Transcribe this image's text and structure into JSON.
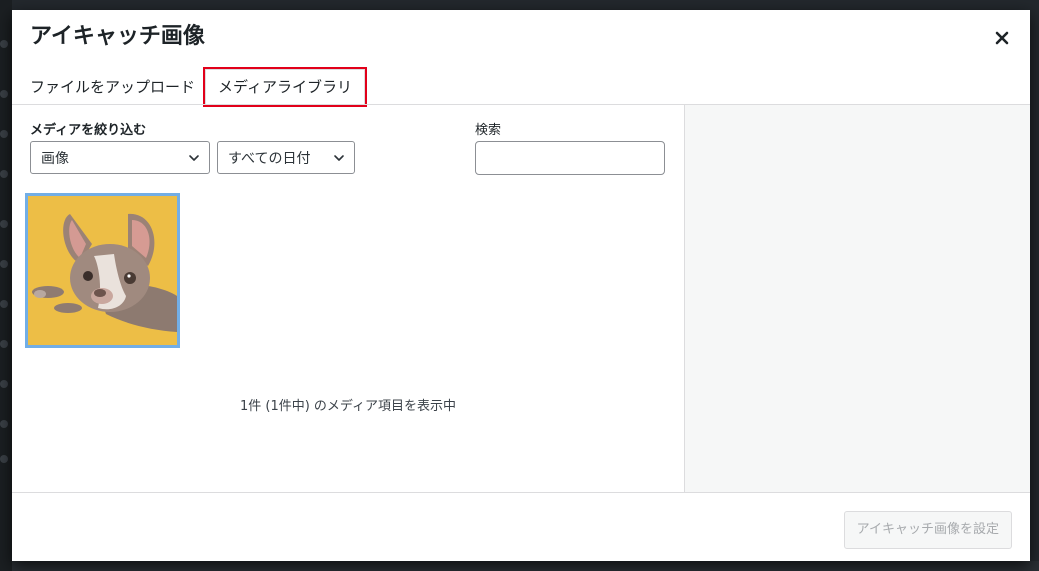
{
  "modal": {
    "title": "アイキャッチ画像",
    "close_icon": "close-icon"
  },
  "tabs": [
    {
      "label": "ファイルをアップロード",
      "active": false
    },
    {
      "label": "メディアライブラリ",
      "active": true,
      "highlight_color": "#e2001a"
    }
  ],
  "filters": {
    "label": "メディアを絞り込む",
    "type_select": {
      "value": "画像",
      "icon": "chevron-down-icon"
    },
    "date_select": {
      "value": "すべての日付",
      "icon": "chevron-down-icon"
    }
  },
  "search": {
    "label": "検索",
    "value": "",
    "placeholder": ""
  },
  "attachments": [
    {
      "alt": "dog photo",
      "selected": false,
      "border_color": "#72aee6"
    }
  ],
  "count_text": "1件 (1件中) のメディア項目を表示中",
  "footer": {
    "set_button_label": "アイキャッチ画像を設定",
    "set_button_disabled": true
  },
  "colors": {
    "accent": "#72aee6",
    "tab_highlight": "#e2001a",
    "background_panel": "#f6f7f7"
  }
}
